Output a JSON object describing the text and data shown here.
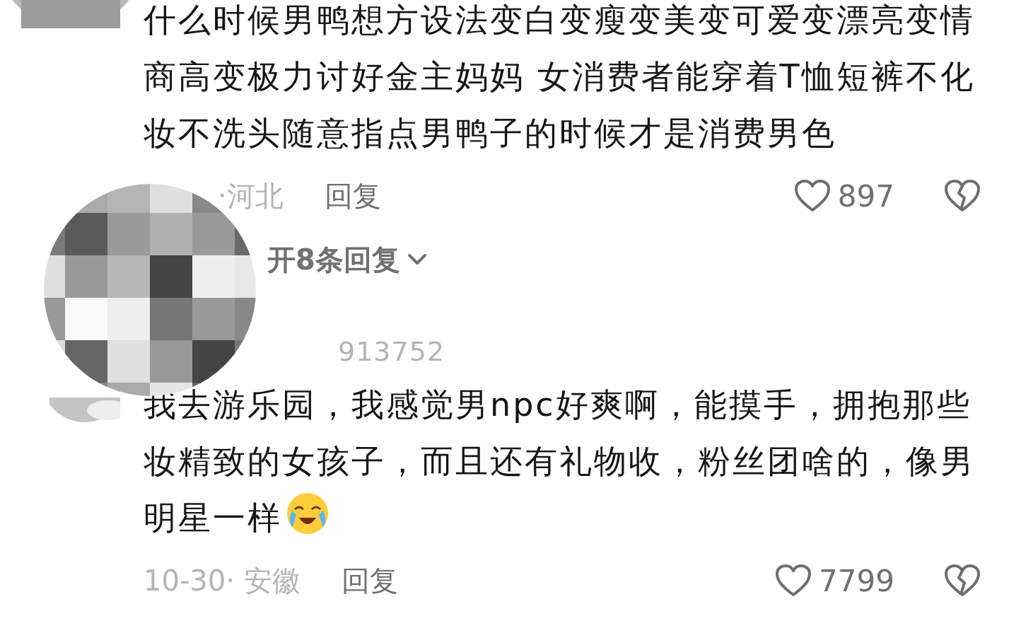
{
  "comments": [
    {
      "body": "什么时候男鸭想方设法变白变瘦变美变可爱变漂亮变情商高变极力讨好金主妈妈 女消费者能穿着T恤短裤不化妆不洗头随意指点男鸭子的时候才是消费男色",
      "meta": "·河北",
      "reply": "回复",
      "likes": "897",
      "expand": "开8条回复"
    },
    {
      "username": "913752",
      "body": "我去游乐园，我感觉男npc好爽啊，能摸手，拥抱那些妆精致的女孩子，而且还有礼物收，粉丝团啥的，像男明星一样",
      "emoji": true,
      "meta": "10-30· 安徽",
      "reply": "回复",
      "likes": "7799"
    }
  ]
}
